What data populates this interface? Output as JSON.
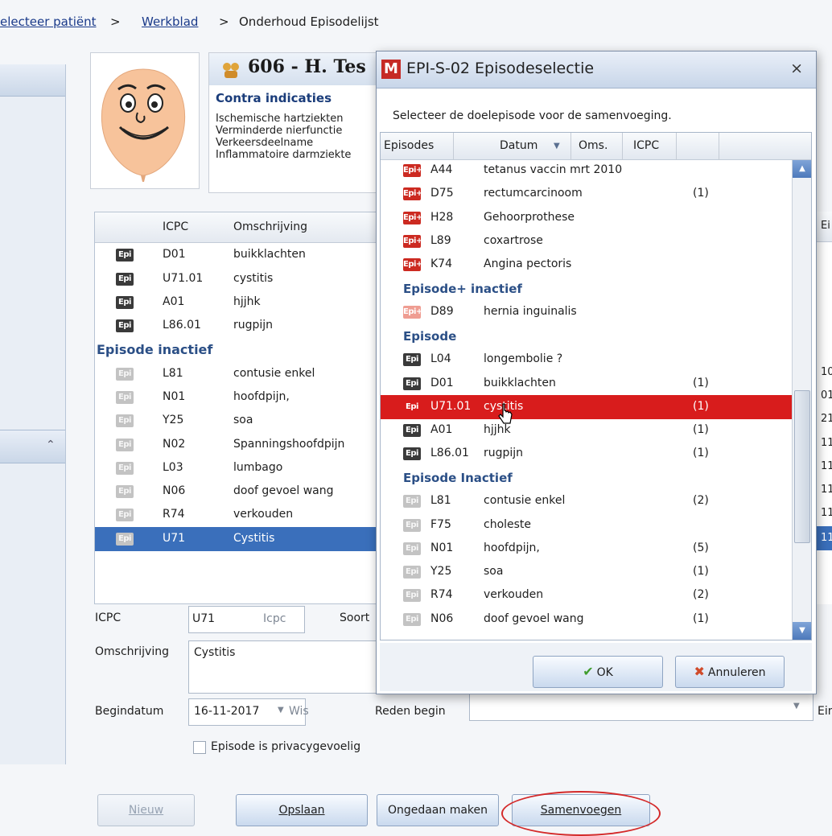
{
  "breadcrumb": {
    "item1": "electeer patiënt",
    "sep1": ">",
    "item2": "Werkblad",
    "sep2": ">",
    "item3": "Onderhoud Episodelijst"
  },
  "patient": {
    "title": "606 - H. Tes",
    "contra_heading": "Contra indicaties",
    "contra_items": [
      "Ischemische hartziekten",
      "Verminderde nierfunctie",
      "Verkeersdeelname",
      "Inflammatoire darmziekte"
    ]
  },
  "episode_table": {
    "columns": [
      "ICPC",
      "Omschrijving"
    ],
    "group_inactive": "Episode inactief",
    "rows": [
      {
        "badge": "Epi",
        "icpc": "D01",
        "desc": "buikklachten"
      },
      {
        "badge": "Epi",
        "icpc": "U71.01",
        "desc": "cystitis"
      },
      {
        "badge": "Epi",
        "icpc": "A01",
        "desc": "hjjhk"
      },
      {
        "badge": "Epi",
        "icpc": "L86.01",
        "desc": "rugpijn"
      }
    ],
    "inactive_rows": [
      {
        "badge": "Epi",
        "icpc": "L81",
        "desc": "contusie enkel"
      },
      {
        "badge": "Epi",
        "icpc": "N01",
        "desc": "hoofdpijn,"
      },
      {
        "badge": "Epi",
        "icpc": "Y25",
        "desc": "soa"
      },
      {
        "badge": "Epi",
        "icpc": "N02",
        "desc": "Spanningshoofdpijn"
      },
      {
        "badge": "Epi",
        "icpc": "L03",
        "desc": "lumbago"
      },
      {
        "badge": "Epi",
        "icpc": "N06",
        "desc": "doof gevoel wang"
      },
      {
        "badge": "Epi",
        "icpc": "R74",
        "desc": "verkouden"
      },
      {
        "badge": "Epi",
        "icpc": "U71",
        "desc": "Cystitis"
      }
    ]
  },
  "right_column": {
    "header": "Ei",
    "values": [
      "10",
      "01",
      "21",
      "11",
      "11",
      "11",
      "11",
      "11"
    ]
  },
  "form": {
    "icpc_label": "ICPC",
    "icpc_value": "U71",
    "icpc_button": "Icpc",
    "soort_label": "Soort",
    "omschrijving_label": "Omschrijving",
    "omschrijving_value": "Cystitis",
    "begindatum_label": "Begindatum",
    "begindatum_value": "16-11-2017",
    "wis_label": "Wis",
    "reden_label": "Reden begin",
    "eind_label": "Eindd",
    "privacy_label": "Episode is privacygevoelig"
  },
  "buttons": {
    "nieuw": "Nieuw",
    "opslaan": "Opslaan",
    "ongedaan": "Ongedaan maken",
    "samenvoegen": "Samenvoegen"
  },
  "dialog": {
    "icon_letter": "M",
    "title": "EPI-S-02 Episodeselectie",
    "close": "×",
    "instruction": "Selecteer de doelepisode voor de samenvoeging.",
    "columns": {
      "episodes": "Episodes",
      "datum": "Datum",
      "oms": "Oms.",
      "icpc": "ICPC"
    },
    "rows_top": [
      {
        "badge": "Epi+",
        "icpc": "A44",
        "desc": "tetanus vaccin mrt 2010",
        "count": ""
      },
      {
        "badge": "Epi+",
        "icpc": "D75",
        "desc": "rectumcarcinoom",
        "count": "(1)"
      },
      {
        "badge": "Epi+",
        "icpc": "H28",
        "desc": "Gehoorprothese",
        "count": ""
      },
      {
        "badge": "Epi+",
        "icpc": "L89",
        "desc": "coxartrose",
        "count": ""
      },
      {
        "badge": "Epi+",
        "icpc": "K74",
        "desc": "Angina pectoris",
        "count": ""
      }
    ],
    "group_plus_inactive": "Episode+ inactief",
    "rows_plus_inactive": [
      {
        "badge": "Epi+",
        "icpc": "D89",
        "desc": "hernia inguinalis",
        "count": ""
      }
    ],
    "group_episode": "Episode",
    "rows_episode": [
      {
        "badge": "Epi",
        "icpc": "L04",
        "desc": "longembolie ?",
        "count": ""
      },
      {
        "badge": "Epi",
        "icpc": "D01",
        "desc": "buikklachten",
        "count": "(1)"
      },
      {
        "badge": "Epi",
        "icpc": "U71.01",
        "desc": "cystitis",
        "count": "(1)"
      },
      {
        "badge": "Epi",
        "icpc": "A01",
        "desc": "hjjhk",
        "count": "(1)"
      },
      {
        "badge": "Epi",
        "icpc": "L86.01",
        "desc": "rugpijn",
        "count": "(1)"
      }
    ],
    "group_inactive": "Episode Inactief",
    "rows_inactive": [
      {
        "badge": "Epi",
        "icpc": "L81",
        "desc": "contusie enkel",
        "count": "(2)"
      },
      {
        "badge": "Epi",
        "icpc": "F75",
        "desc": "choleste",
        "count": ""
      },
      {
        "badge": "Epi",
        "icpc": "N01",
        "desc": "hoofdpijn,",
        "count": "(5)"
      },
      {
        "badge": "Epi",
        "icpc": "Y25",
        "desc": "soa",
        "count": "(1)"
      },
      {
        "badge": "Epi",
        "icpc": "R74",
        "desc": "verkouden",
        "count": "(2)"
      },
      {
        "badge": "Epi",
        "icpc": "N06",
        "desc": "doof gevoel wang",
        "count": "(1)"
      }
    ],
    "ok": "OK",
    "annuleren": "Annuleren"
  },
  "colors": {
    "selected_blue": "#3a6fbb",
    "highlight_red": "#d81c1c",
    "group_heading": "#2b4f86",
    "annotation_circle": "#d42a2a"
  }
}
